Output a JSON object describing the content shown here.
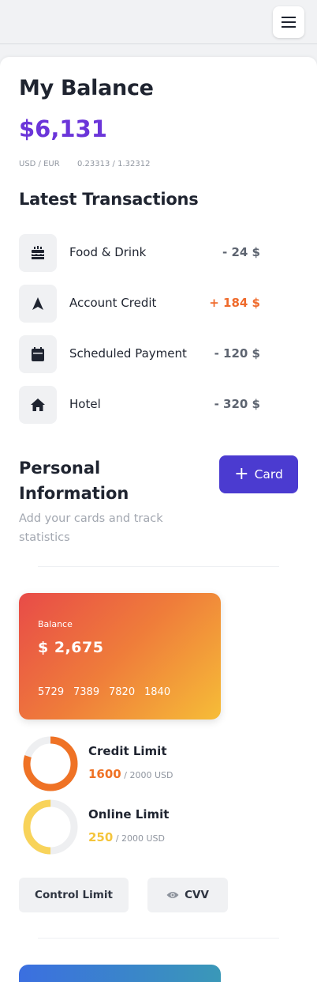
{
  "header": {
    "menu_icon": "hamburger-menu-icon"
  },
  "balance": {
    "title": "My Balance",
    "amount": "$6,131",
    "pair_label": "USD / EUR",
    "pair_rate": "0.23313 / 1.32312"
  },
  "transactions": {
    "title": "Latest Transactions",
    "items": [
      {
        "icon": "cake-icon",
        "label": "Food & Drink",
        "amount": "- 24 $"
      },
      {
        "icon": "navigation-arrow-icon",
        "label": "Account Credit",
        "amount": "+ 184 $"
      },
      {
        "icon": "calendar-icon",
        "label": "Scheduled Payment",
        "amount": "- 120 $"
      },
      {
        "icon": "home-icon",
        "label": "Hotel",
        "amount": "- 320 $"
      }
    ]
  },
  "personal": {
    "title": "Personal Information",
    "subtitle": "Add your cards and track statistics",
    "add_card_label": "Card"
  },
  "card": {
    "label": "Balance",
    "amount": "$ 2,675",
    "number": [
      "5729",
      "7389",
      "7820",
      "1840"
    ]
  },
  "limits": [
    {
      "title": "Credit Limit",
      "value": "1600",
      "suffix": "/ 2000 USD",
      "fraction": 0.8,
      "color": "#ef7225"
    },
    {
      "title": "Online Limit",
      "value": "250",
      "suffix": "/ 2000 USD",
      "fraction": 0.5,
      "color": "#f8d35a"
    }
  ],
  "actions": {
    "control_limit": "Control Limit",
    "cvv": "CVV"
  },
  "colors": {
    "accent_purple": "#6b35d9",
    "button_indigo": "#4b3bd0",
    "credit_orange": "#ef6a2b"
  }
}
